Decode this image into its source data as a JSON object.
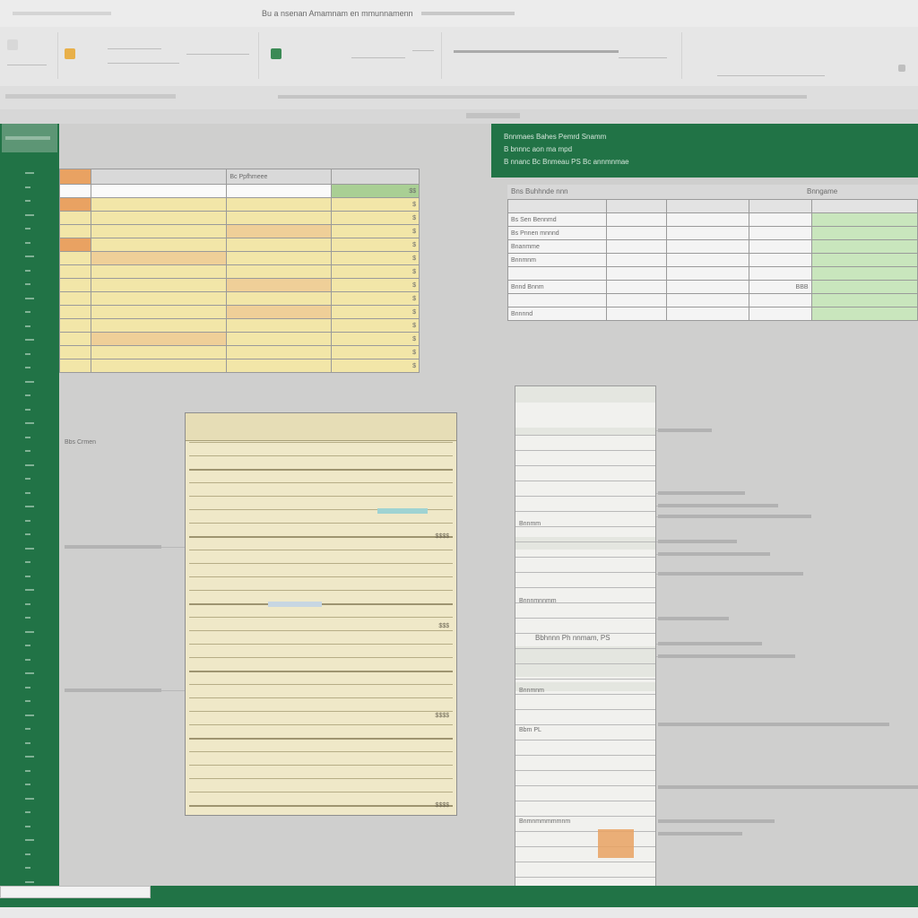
{
  "titlebar": {
    "left": "",
    "center": "Bu a nsenan Amamnam en mmunnamenn",
    "right": ""
  },
  "ribbon": {
    "labels": [
      "",
      "",
      "",
      "",
      "",
      ""
    ]
  },
  "colors": {
    "excel_green": "#217346",
    "cell_yellow": "#f2e6a8",
    "cell_orange": "#e9a262",
    "cell_green": "#c9e6bd"
  },
  "left_panel": {
    "label": "Bbs Crmen"
  },
  "tableA": {
    "header": [
      "",
      "",
      "Bc Ppfhmeee",
      ""
    ],
    "first_row": [
      "",
      "",
      "",
      "$$"
    ],
    "rows": [
      [
        "",
        "",
        "",
        "$"
      ],
      [
        "",
        "",
        "",
        "$"
      ],
      [
        "",
        "",
        "",
        "$"
      ],
      [
        "",
        "",
        "",
        "$"
      ],
      [
        "",
        "",
        "",
        "$"
      ],
      [
        "",
        "",
        "",
        "$"
      ],
      [
        "",
        "",
        "",
        "$"
      ],
      [
        "",
        "",
        "",
        "$"
      ],
      [
        "",
        "",
        "",
        "$"
      ],
      [
        "",
        "",
        "",
        "$"
      ],
      [
        "",
        "",
        "",
        "$"
      ],
      [
        "",
        "",
        "",
        "$"
      ],
      [
        "",
        "",
        "",
        "$"
      ]
    ]
  },
  "greenbanner": {
    "line1": "Bnnmaes Bahes Pemrd Snamm",
    "line2": "B bnnnc aon ma mpd",
    "line3": "B nnanc Bc Bnmeau PS Bc annmnmae"
  },
  "tableB": {
    "title": "Bns Buhhnde nnn",
    "right_title": "Bnngame",
    "rows": [
      [
        "",
        "",
        "",
        "",
        ""
      ],
      [
        "Bs Sen Bennmd",
        "",
        "",
        "",
        ""
      ],
      [
        "Bs Pnnen mnnnd",
        "",
        "",
        "",
        ""
      ],
      [
        "Bnanmme",
        "",
        "",
        "",
        ""
      ],
      [
        "Bnnmnm",
        "",
        "",
        "",
        ""
      ],
      [
        "",
        "",
        "",
        "",
        ""
      ],
      [
        "Bnnd Bnnm",
        "",
        "",
        "BBB",
        ""
      ],
      [
        "",
        "",
        "",
        "",
        ""
      ],
      [
        "Bnnnnd",
        "",
        "",
        "",
        ""
      ]
    ]
  },
  "formC": {
    "lines": [
      "",
      "",
      "",
      "",
      "",
      "",
      "",
      "",
      "",
      "",
      "",
      "",
      "",
      ""
    ],
    "right_values": [
      "$$$$",
      "$$$",
      "$$$$",
      "$$$$",
      "$$$$"
    ]
  },
  "colD": {
    "sections": [
      "Bnnmm",
      "Bnnnmnnmm",
      "Bbhnnn Ph nnmam, PS",
      "Bnnmnm",
      "Bbm PL",
      "Bnmnmmmmmnm"
    ]
  },
  "annotations": {
    "left": [
      "Bbs Crmen",
      "",
      ""
    ],
    "right": [
      "",
      "",
      "",
      "",
      "",
      "",
      "",
      "",
      "",
      ""
    ]
  },
  "status": {
    "sheet_tab": ""
  }
}
